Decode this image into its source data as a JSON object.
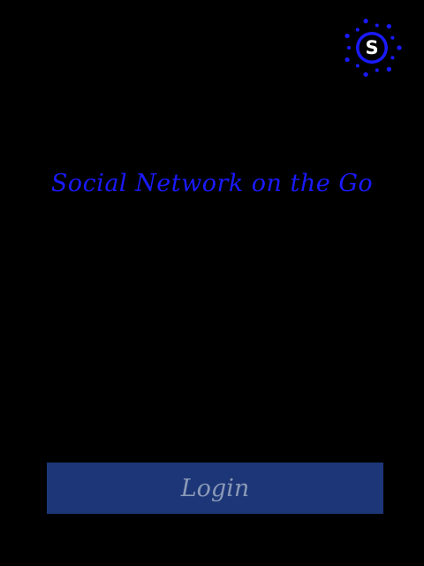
{
  "logo": {
    "letter": "S",
    "icon": "sparkle-s-logo-icon",
    "color": "#1a1aff"
  },
  "tagline": "Social Network on the Go",
  "login_button": {
    "label": "Login",
    "background": "#1c3677",
    "text_color": "#8b9ab8"
  },
  "colors": {
    "background": "#000000",
    "accent": "#1a1aff"
  }
}
